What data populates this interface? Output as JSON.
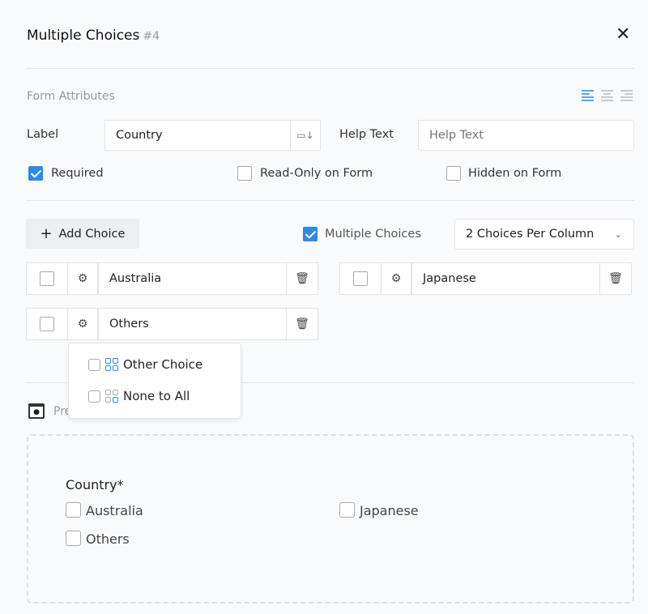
{
  "header": {
    "title": "Multiple Choices",
    "number": "#4",
    "close_icon": "close-icon"
  },
  "form_attributes": {
    "section_label": "Form Attributes",
    "alignment_options": [
      "align-left",
      "align-center",
      "align-right"
    ],
    "alignment_selected": "align-left",
    "label_caption": "Label",
    "label_value": "Country",
    "help_text_caption": "Help Text",
    "help_text_placeholder": "Help Text",
    "help_text_value": "",
    "required": {
      "label": "Required",
      "checked": true
    },
    "read_only": {
      "label": "Read-Only on Form",
      "checked": false
    },
    "hidden": {
      "label": "Hidden on Form",
      "checked": false
    }
  },
  "choices_toolbar": {
    "add_choice": "Add Choice",
    "multiple_choices": {
      "label": "Multiple Choices",
      "checked": true
    },
    "per_column": "2 Choices Per Column"
  },
  "choices": [
    {
      "value": "Australia",
      "checked": false
    },
    {
      "value": "Japanese",
      "checked": false
    },
    {
      "value": "Others",
      "checked": false
    }
  ],
  "choice_settings_menu": [
    {
      "label": "Other Choice",
      "checked": false
    },
    {
      "label": "None to All",
      "checked": false
    }
  ],
  "preview": {
    "label": "Preview",
    "field_label": "Country*",
    "options": [
      "Australia",
      "Japanese",
      "Others"
    ]
  },
  "colors": {
    "accent": "#2d8ae6"
  }
}
